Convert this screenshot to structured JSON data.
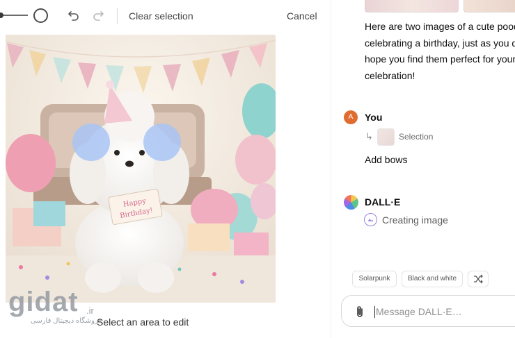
{
  "toolbar": {
    "clear_selection_label": "Clear selection",
    "cancel_label": "Cancel",
    "icons": {
      "undo": "undo-icon",
      "redo": "redo-icon"
    }
  },
  "canvas": {
    "sign_text": "Happy Birthday!",
    "hint": "Select an area to edit"
  },
  "chat": {
    "assistant_reply_lines": [
      "Here are two images of a cute poodle",
      "celebrating a birthday, just as you de",
      "hope you find them perfect for your",
      "celebration!"
    ],
    "user_message": {
      "name": "You",
      "avatar_letter": "A",
      "selection_label": "Selection",
      "text": "Add bows"
    },
    "assistant": {
      "name": "DALL·E",
      "status": "Creating image"
    }
  },
  "suggestions": {
    "chip1": "Solarpunk",
    "chip2": "Black and white",
    "shuffle_icon": "shuffle-icon"
  },
  "composer": {
    "placeholder": "Message DALL·E…"
  },
  "watermark": {
    "logo": "gidat",
    "domain": ".ir",
    "tagline": "فروشگاه دیجیتال فارسی"
  },
  "colors": {
    "user_avatar": "#e06c2f",
    "selection_brush": "#a9c4f5",
    "creating_accent": "#9c7fe0"
  }
}
